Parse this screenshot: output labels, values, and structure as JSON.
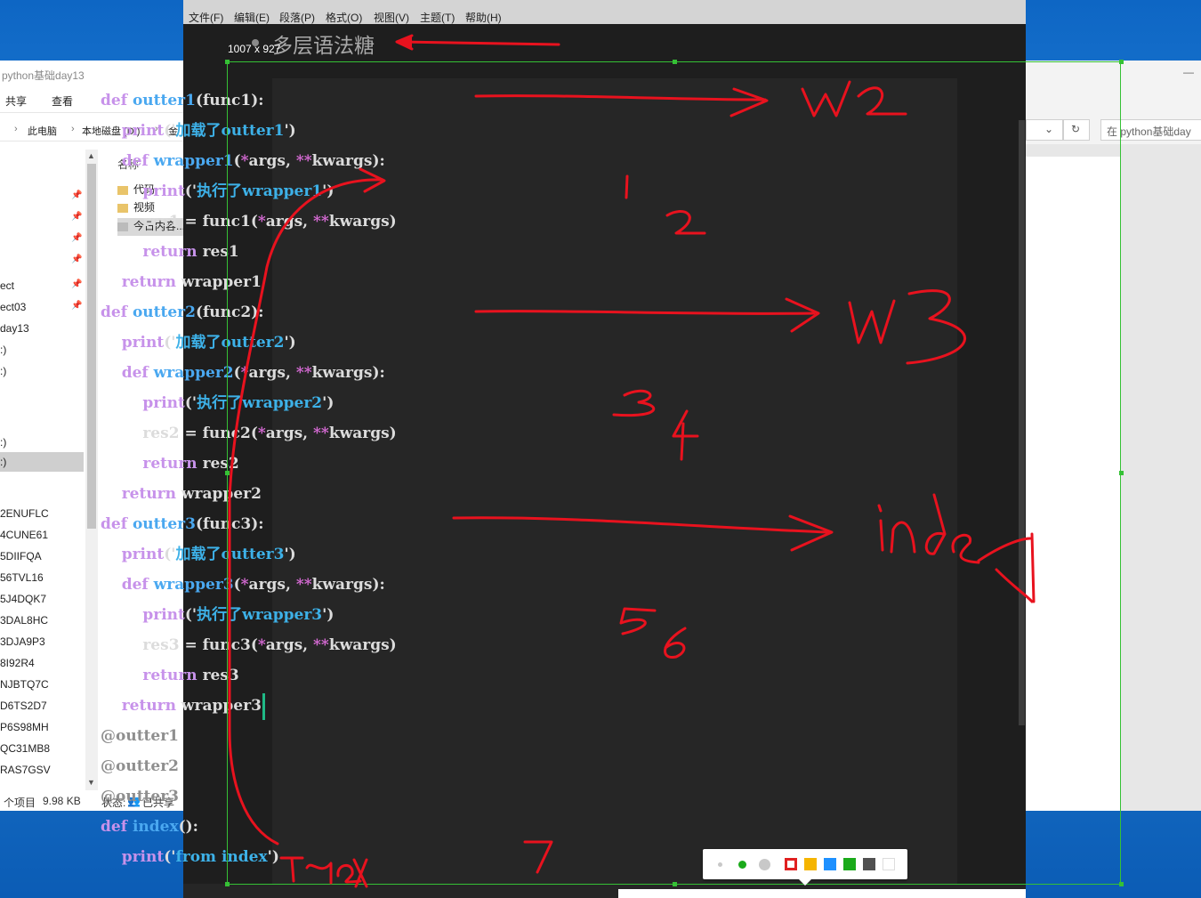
{
  "explorer": {
    "title": "python基础day13",
    "ribbon": [
      "共享",
      "查看"
    ],
    "breadcrumb": [
      "此电脑",
      "本地磁盘 (D:)",
      "金"
    ],
    "nav_items": [
      "ect",
      "ect03",
      "day13",
      ":)",
      ":)",
      ":)",
      ":)",
      "2ENUFLC",
      "4CUNE61",
      "5DIIFQA",
      "56TVL16",
      "5J4DQK7",
      "3DAL8HC",
      "3DJA9P3",
      "8I92R4",
      "NJBTQ7C",
      "D6TS2D7",
      "P6S98MH",
      "QC31MB8",
      "RAS7GSV"
    ],
    "column_header": "名称",
    "files": [
      "代码",
      "视频",
      "今日内容..."
    ],
    "status_items": "个项目",
    "status_size": "9.98 KB",
    "status_state": "状态:",
    "status_shared": "已共享"
  },
  "right_window": {
    "search_placeholder": "在 python基础day",
    "refresh_icon": "↻",
    "dropdown_icon": "⌄",
    "minimize_icon": "—"
  },
  "editor": {
    "menu": [
      "文件(F)",
      "编辑(E)",
      "段落(P)",
      "格式(O)",
      "视图(V)",
      "主题(T)",
      "帮助(H)"
    ],
    "heading": "多层语法糖",
    "selection_size": "1007 x 927"
  },
  "code_lines": [
    [
      [
        "kw",
        "def "
      ],
      [
        "fn",
        "outter1"
      ],
      [
        "",
        "(func1):"
      ]
    ],
    [
      [
        "",
        "    "
      ],
      [
        "kw",
        "print"
      ],
      [
        "",
        "('"
      ],
      [
        "st",
        "加载了outter1"
      ],
      [
        "",
        "')"
      ]
    ],
    [
      [
        "",
        "    "
      ],
      [
        "kw",
        "def "
      ],
      [
        "fn",
        "wrapper1"
      ],
      [
        "",
        "("
      ],
      [
        "op",
        "*"
      ],
      [
        "",
        "args, "
      ],
      [
        "op",
        "**"
      ],
      [
        "",
        "kwargs):"
      ]
    ],
    [
      [
        "",
        "        "
      ],
      [
        "kw",
        "print"
      ],
      [
        "",
        "('"
      ],
      [
        "st",
        "执行了wrapper1"
      ],
      [
        "",
        "')"
      ]
    ],
    [
      [
        "",
        "        res1 = func1("
      ],
      [
        "op",
        "*"
      ],
      [
        "",
        "args, "
      ],
      [
        "op",
        "**"
      ],
      [
        "",
        "kwargs)"
      ]
    ],
    [
      [
        "",
        "        "
      ],
      [
        "kw",
        "return"
      ],
      [
        "",
        ". res1"
      ]
    ],
    [
      [
        "",
        "    "
      ],
      [
        "kw",
        "return"
      ],
      [
        "",
        ". wrapper1"
      ]
    ],
    [
      [
        "kw",
        "def "
      ],
      [
        "fn",
        "outter2"
      ],
      [
        "",
        "(func2):"
      ]
    ],
    [
      [
        "",
        "    "
      ],
      [
        "kw",
        "print"
      ],
      [
        "",
        "('"
      ],
      [
        "st",
        "加载了outter2"
      ],
      [
        "",
        "')"
      ]
    ],
    [
      [
        "",
        "    "
      ],
      [
        "kw",
        "def "
      ],
      [
        "fn",
        "wrapper2"
      ],
      [
        "",
        "("
      ],
      [
        "op",
        "*"
      ],
      [
        "",
        "args, "
      ],
      [
        "op",
        "**"
      ],
      [
        "",
        "kwargs):"
      ]
    ],
    [
      [
        "",
        "        "
      ],
      [
        "kw",
        "print"
      ],
      [
        "",
        "('"
      ],
      [
        "st",
        "执行了wrapper2"
      ],
      [
        "",
        "')"
      ]
    ],
    [
      [
        "",
        "        res2 = func2("
      ],
      [
        "op",
        "*"
      ],
      [
        "",
        "args, "
      ],
      [
        "op",
        "**"
      ],
      [
        "",
        "kwargs)"
      ]
    ],
    [
      [
        "",
        "        "
      ],
      [
        "kw",
        "return"
      ],
      [
        "",
        ". res2"
      ]
    ],
    [
      [
        "",
        "    "
      ],
      [
        "kw",
        "return"
      ],
      [
        "",
        ". wrapper2"
      ]
    ],
    [
      [
        "kw",
        "def "
      ],
      [
        "fn",
        "outter3"
      ],
      [
        "",
        "(func3):"
      ]
    ],
    [
      [
        "",
        "    "
      ],
      [
        "kw",
        "print"
      ],
      [
        "",
        "('"
      ],
      [
        "st",
        "加载了outter3"
      ],
      [
        "",
        "')"
      ]
    ],
    [
      [
        "",
        "    "
      ],
      [
        "kw",
        "def "
      ],
      [
        "fn",
        "wrapper3"
      ],
      [
        "",
        "("
      ],
      [
        "op",
        "*"
      ],
      [
        "",
        "args, "
      ],
      [
        "op",
        "**"
      ],
      [
        "",
        "kwargs):"
      ]
    ],
    [
      [
        "",
        "        "
      ],
      [
        "kw",
        "print"
      ],
      [
        "",
        "('"
      ],
      [
        "st",
        "执行了wrapper3"
      ],
      [
        "",
        "')"
      ]
    ],
    [
      [
        "",
        "        res3 = func3("
      ],
      [
        "op",
        "*"
      ],
      [
        "",
        "args, "
      ],
      [
        "op",
        "**"
      ],
      [
        "",
        "kwargs)"
      ]
    ],
    [
      [
        "",
        "        "
      ],
      [
        "kw",
        "return"
      ],
      [
        "",
        ". res3"
      ]
    ],
    [
      [
        "",
        "    "
      ],
      [
        "kw",
        "return"
      ],
      [
        "",
        ". wrapper3"
      ],
      [
        "caret",
        ""
      ]
    ],
    [
      [
        "dc",
        "@outter1"
      ]
    ],
    [
      [
        "dc",
        "@outter2"
      ]
    ],
    [
      [
        "dc",
        "@outter3"
      ]
    ],
    [
      [
        "kw",
        "def "
      ],
      [
        "fn",
        "index"
      ],
      [
        "",
        "():"
      ]
    ],
    [
      [
        "",
        "    "
      ],
      [
        "kw",
        "print"
      ],
      [
        "",
        "('"
      ],
      [
        "st",
        "from index"
      ],
      [
        "",
        "')"
      ]
    ]
  ],
  "snip_toolbar": {
    "swatches": [
      "#e02020",
      "#f5b400",
      "#1e90ff",
      "#1aaa1a",
      "#505050",
      "#ffffff"
    ],
    "size_dots": [
      "small",
      "medium",
      "large"
    ]
  },
  "accent_colors": {
    "ink": "#e8121e",
    "selection": "#35c135"
  }
}
